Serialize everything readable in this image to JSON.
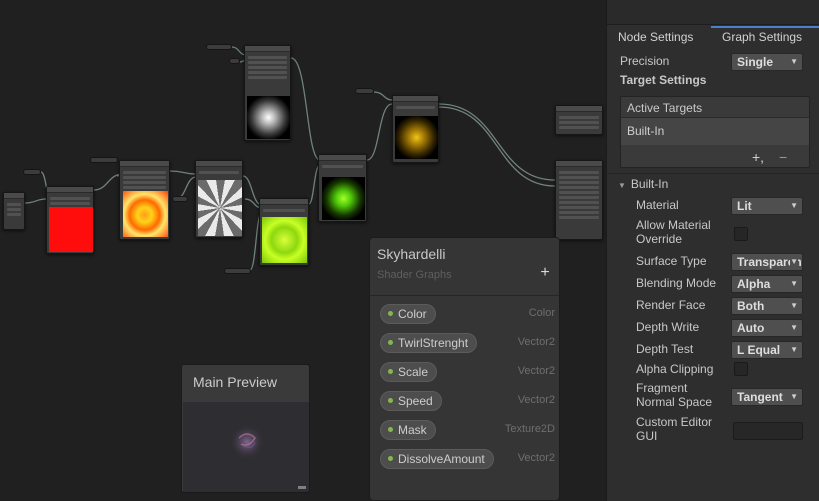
{
  "blackboard": {
    "title": "Skyhardelli",
    "subtitle": "Shader Graphs",
    "add_label": "+",
    "properties": [
      {
        "name": "Color",
        "type": "Color"
      },
      {
        "name": "TwirlStrenght",
        "type": "Vector2"
      },
      {
        "name": "Scale",
        "type": "Vector2"
      },
      {
        "name": "Speed",
        "type": "Vector2"
      },
      {
        "name": "Mask",
        "type": "Texture2D"
      },
      {
        "name": "DissolveAmount",
        "type": "Vector2"
      }
    ]
  },
  "main_preview": {
    "title": "Main Preview"
  },
  "inspector": {
    "tabs": [
      {
        "label": "Node Settings"
      },
      {
        "label": "Graph Settings"
      }
    ],
    "precision": {
      "label": "Precision",
      "value": "Single"
    },
    "target_settings_label": "Target Settings",
    "active_targets": {
      "header": "Active Targets",
      "items": [
        "Built-In"
      ],
      "add_label": "+,",
      "remove_label": "−"
    },
    "builtin_section": {
      "foldout_arrow": "▼",
      "label": "Built-In",
      "settings": [
        {
          "label": "Material",
          "value": "Lit"
        },
        {
          "label": "Allow Material\nOverride"
        },
        {
          "label": "Surface Type",
          "value": "Transparent"
        },
        {
          "label": "Blending Mode",
          "value": "Alpha"
        },
        {
          "label": "Render Face",
          "value": "Both"
        },
        {
          "label": "Depth Write",
          "value": "Auto"
        },
        {
          "label": "Depth Test",
          "value": "L Equal"
        },
        {
          "label": "Alpha Clipping"
        },
        {
          "label": "Fragment\nNormal Space",
          "value": "Tangent"
        },
        {
          "label": "Custom Editor\nGUI"
        }
      ]
    }
  },
  "colors": {
    "canvas_bg": "#202020",
    "node_bg": "#3a3a3a",
    "panel_bg": "#2e2e2e",
    "blackboard_bg": "#353535",
    "tab_accent": "#4b81c8",
    "property_dot": "#84b84c",
    "wire": "#8aa39b"
  }
}
